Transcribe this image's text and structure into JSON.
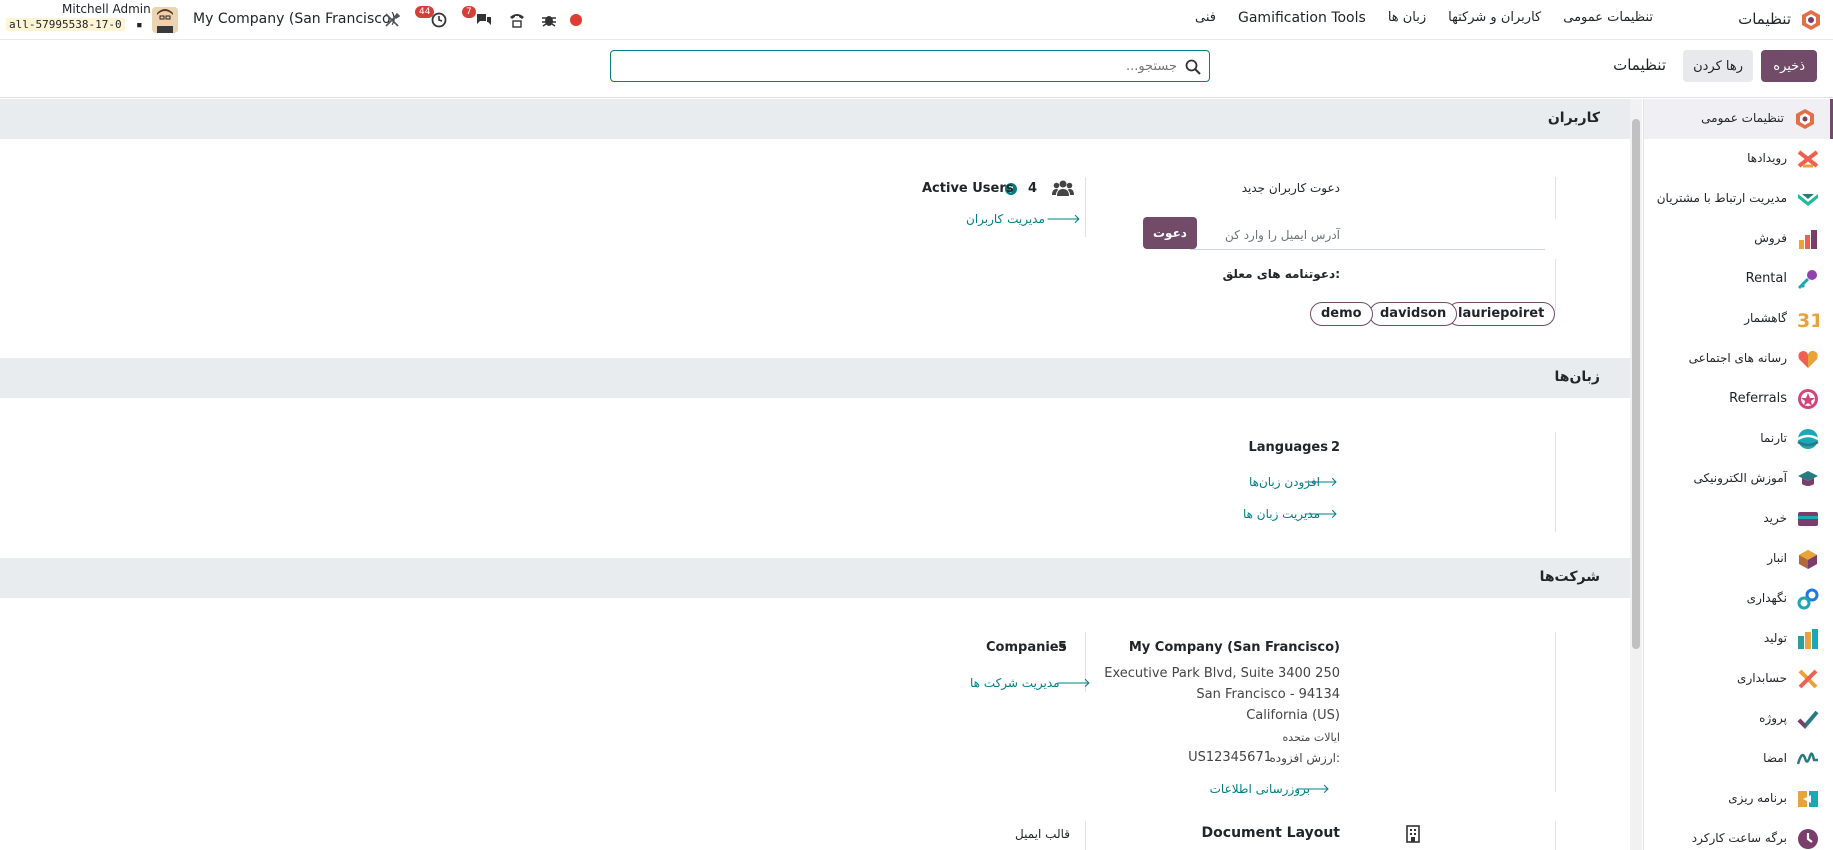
{
  "navbar": {
    "app_name": "تنظیمات",
    "menu": [
      "تنظیمات عمومی",
      "کاربران و شرکتها",
      "زبان ها",
      "Gamification Tools",
      "فنی"
    ],
    "user_name": "Mitchell Admin",
    "db_name": "all-57995538-17-0",
    "company": "My Company (San Francisco)",
    "activity_badge": "44",
    "messages_badge": "7"
  },
  "controls": {
    "save_label": "ذخیره",
    "discard_label": "رها کردن",
    "title": "تنظیمات",
    "search_placeholder": "جستجو..."
  },
  "sidebar": {
    "items": [
      {
        "label": "تنظیمات عمومی",
        "icon": "settings-app-icon",
        "color": "#e46f47"
      },
      {
        "label": "رویدادها",
        "icon": "events-app-icon",
        "color": "#f06050"
      },
      {
        "label": "مدیریت ارتباط با مشتریان",
        "icon": "crm-app-icon",
        "color": "#1abc9c"
      },
      {
        "label": "فروش",
        "icon": "sales-app-icon",
        "color": "#e8a33a"
      },
      {
        "label": "Rental",
        "icon": "rental-app-icon",
        "color": "#8e44ad"
      },
      {
        "label": "گاهشمار",
        "icon": "calendar-app-icon",
        "color": "#e8a33a"
      },
      {
        "label": "رسانه های اجتماعی",
        "icon": "social-app-icon",
        "color": "#f06050"
      },
      {
        "label": "Referrals",
        "icon": "referrals-app-icon",
        "color": "#d4467a"
      },
      {
        "label": "تارنما",
        "icon": "website-app-icon",
        "color": "#1aa8b7"
      },
      {
        "label": "آموزش الکترونیکی",
        "icon": "elearning-app-icon",
        "color": "#2a7b7f"
      },
      {
        "label": "خرید",
        "icon": "purchase-app-icon",
        "color": "#7b3d6b"
      },
      {
        "label": "انبار",
        "icon": "inventory-app-icon",
        "color": "#b06a3a"
      },
      {
        "label": "نگهداری",
        "icon": "maintenance-app-icon",
        "color": "#1f7ae0"
      },
      {
        "label": "تولید",
        "icon": "manufacturing-app-icon",
        "color": "#2aa198"
      },
      {
        "label": "حسابداری",
        "icon": "accounting-app-icon",
        "color": "#e8a33a"
      },
      {
        "label": "پروژه",
        "icon": "project-app-icon",
        "color": "#2a7b7f"
      },
      {
        "label": "امضا",
        "icon": "sign-app-icon",
        "color": "#2a7b7f"
      },
      {
        "label": "برنامه ریزی",
        "icon": "planning-app-icon",
        "color": "#e8a33a"
      },
      {
        "label": "برگه ساعت کارکرد",
        "icon": "timesheet-app-icon",
        "color": "#7b3d6b"
      }
    ]
  },
  "users": {
    "section_title": "کاربران",
    "invite_title": "دعوت کاربران جدید",
    "email_placeholder": "آدرس ایمیل را وارد کن",
    "invite_button": "دعوت",
    "pending_label": "دعوتنامه های معلق:",
    "pending": [
      "lauriepoiret",
      "davidson",
      "demo"
    ],
    "active_count": "4",
    "active_label": "Active Users",
    "manage_link": "مدیریت کاربران"
  },
  "languages": {
    "section_title": "زبان‌ها",
    "count": "2",
    "label": "Languages",
    "add_link": "افزودن زبان‌ها",
    "manage_link": "مدیریت زبان ها"
  },
  "companies": {
    "section_title": "شرکت‌ها",
    "name": "My Company (San Francisco)",
    "address1": "Executive Park Blvd, Suite 3400 250",
    "address2": "San Francisco - 94134",
    "address3": "California (US)",
    "country": "ایالات متحده",
    "vat_label": "ارزش افزوده:",
    "vat_value": "US12345671",
    "update_link": "بروزرسانی اطلاعات",
    "count": "5",
    "count_label": "Companies",
    "manage_link": "مدیریت شرکت ها",
    "doc_layout": "Document Layout",
    "email_template": "قالب ایمیل"
  }
}
